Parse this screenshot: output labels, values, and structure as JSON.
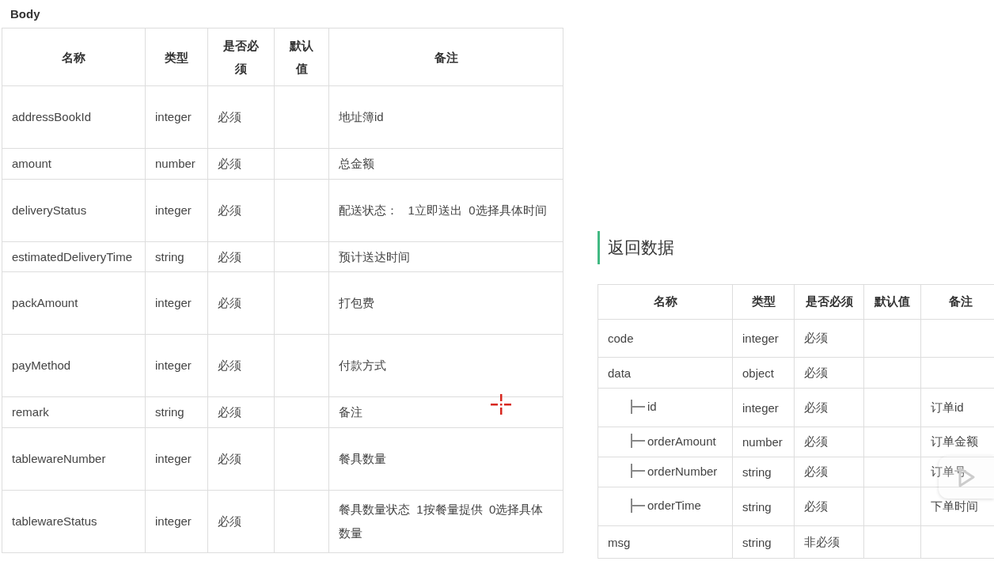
{
  "body_section": {
    "title": "Body",
    "columns": [
      "名称",
      "类型",
      "是否必须",
      "默认值",
      "备注"
    ],
    "rows": [
      {
        "name": "addressBookId",
        "type": "integer",
        "required": "必须",
        "default": "",
        "note": "地址簿id"
      },
      {
        "name": "amount",
        "type": "number",
        "required": "必须",
        "default": "",
        "note": "总金额"
      },
      {
        "name": "deliveryStatus",
        "type": "integer",
        "required": "必须",
        "default": "",
        "note": "配送状态：   1立即送出  0选择具体时间"
      },
      {
        "name": "estimatedDeliveryTime",
        "type": "string",
        "required": "必须",
        "default": "",
        "note": "预计送达时间"
      },
      {
        "name": "packAmount",
        "type": "integer",
        "required": "必须",
        "default": "",
        "note": "打包费"
      },
      {
        "name": "payMethod",
        "type": "integer",
        "required": "必须",
        "default": "",
        "note": "付款方式"
      },
      {
        "name": "remark",
        "type": "string",
        "required": "必须",
        "default": "",
        "note": "备注"
      },
      {
        "name": "tablewareNumber",
        "type": "integer",
        "required": "必须",
        "default": "",
        "note": "餐具数量"
      },
      {
        "name": "tablewareStatus",
        "type": "integer",
        "required": "必须",
        "default": "",
        "note": "餐具数量状态  1按餐量提供  0选择具体数量"
      }
    ]
  },
  "response_section": {
    "title": "返回数据",
    "columns": [
      "名称",
      "类型",
      "是否必须",
      "默认值",
      "备注"
    ],
    "rows": [
      {
        "name": "code",
        "type": "integer",
        "required": "必须",
        "note": ""
      },
      {
        "name": "data",
        "type": "object",
        "required": "必须",
        "note": "",
        "children": [
          {
            "name": "id",
            "type": "integer",
            "required": "必须",
            "note": "订单id"
          },
          {
            "name": "orderAmount",
            "type": "number",
            "required": "必须",
            "note": "订单金额"
          },
          {
            "name": "orderNumber",
            "type": "string",
            "required": "必须",
            "note": "订单号"
          },
          {
            "name": "orderTime",
            "type": "string",
            "required": "必须",
            "note": "下单时间"
          }
        ]
      },
      {
        "name": "msg",
        "type": "string",
        "required": "非必须",
        "note": ""
      }
    ]
  }
}
